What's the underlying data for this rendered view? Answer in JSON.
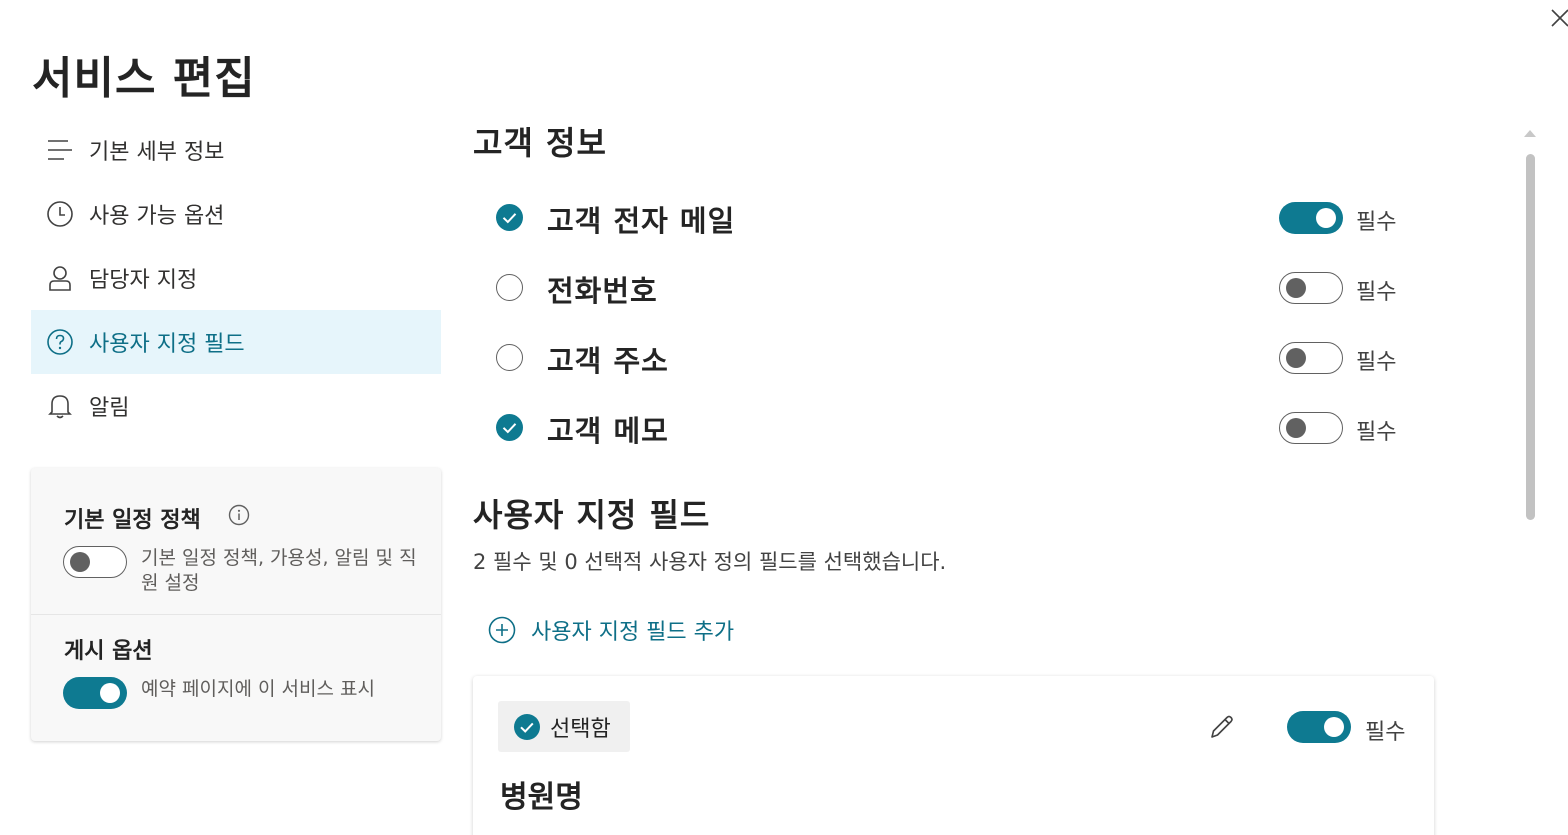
{
  "page": {
    "title": "서비스 편집"
  },
  "nav": {
    "items": [
      {
        "label": "기본 세부 정보",
        "icon": "lines-icon"
      },
      {
        "label": "사용 가능 옵션",
        "icon": "clock-icon"
      },
      {
        "label": "담당자 지정",
        "icon": "person-icon"
      },
      {
        "label": "사용자 지정 필드",
        "icon": "question-circle-icon",
        "active": true
      },
      {
        "label": "알림",
        "icon": "bell-icon"
      }
    ]
  },
  "side_card": {
    "default_policy": {
      "title": "기본 일정 정책",
      "description": "기본 일정 정책, 가용성, 알림 및 직원 설정",
      "toggle_on": false
    },
    "publish": {
      "title": "게시 옵션",
      "description": "예약 페이지에 이 서비스 표시",
      "toggle_on": true
    }
  },
  "customer_info": {
    "title": "고객 정보",
    "required_label": "필수",
    "fields": [
      {
        "label": "고객 전자 메일",
        "checked": true,
        "required": true
      },
      {
        "label": "전화번호",
        "checked": false,
        "required": false
      },
      {
        "label": "고객 주소",
        "checked": false,
        "required": false
      },
      {
        "label": "고객 메모",
        "checked": true,
        "required": false
      }
    ]
  },
  "custom_fields": {
    "title": "사용자 지정 필드",
    "description": "2 필수 및 0 선택적 사용자 정의 필드를 선택했습니다.",
    "add_label": "사용자 지정 필드 추가",
    "card": {
      "chip_label": "선택함",
      "required_label": "필수",
      "required": true,
      "field_name": "병원명"
    }
  },
  "colors": {
    "accent": "#0e7a91",
    "active_nav_bg": "#e6f5fb",
    "link": "#0e6f87"
  }
}
